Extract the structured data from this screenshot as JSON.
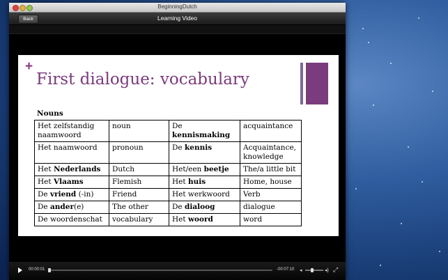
{
  "window": {
    "title": "BeginningDutch"
  },
  "navbar": {
    "back_label": "Back",
    "title": "Learning Video"
  },
  "slide": {
    "title": "First dialogue: vocabulary",
    "section": "Nouns",
    "rows": [
      {
        "dutch_prefix": "Het zelfstandig naamwoord",
        "dutch_bold": "",
        "dutch_suffix": "",
        "type": "noun",
        "nl": [
          "De ",
          "kennismaking",
          ""
        ],
        "en": "acquaintance"
      },
      {
        "dutch_prefix": "Het naamwoord",
        "dutch_bold": "",
        "dutch_suffix": "",
        "type": "pronoun",
        "nl": [
          "De ",
          "kennis",
          ""
        ],
        "en": "Acquaintance, knowledge"
      },
      {
        "dutch_prefix": "Het ",
        "dutch_bold": "Nederlands",
        "dutch_suffix": "",
        "type": "Dutch",
        "nl": [
          "Het/een ",
          "beetje",
          ""
        ],
        "en": "The/a little bit"
      },
      {
        "dutch_prefix": "Het ",
        "dutch_bold": "Vlaams",
        "dutch_suffix": "",
        "type": "Flemish",
        "nl": [
          "Het ",
          "huis",
          ""
        ],
        "en": "Home, house"
      },
      {
        "dutch_prefix": "De ",
        "dutch_bold": "vriend",
        "dutch_suffix": " (-in)",
        "type": "Friend",
        "nl": [
          "Het werkwoord",
          "",
          ""
        ],
        "en": "Verb"
      },
      {
        "dutch_prefix": "De ",
        "dutch_bold": "ander",
        "dutch_suffix": "(e)",
        "type": "The other",
        "nl": [
          "De ",
          "dialoog",
          ""
        ],
        "en": "dialogue"
      },
      {
        "dutch_prefix": "De woordenschat",
        "dutch_bold": "",
        "dutch_suffix": "",
        "type": "vocabulary",
        "nl": [
          "Het ",
          "woord",
          ""
        ],
        "en": "word"
      }
    ]
  },
  "controls": {
    "current_time": "00:00:01",
    "remaining_time": "-00:07:10",
    "progress_fraction": 0.003,
    "volume_fraction": 0.4
  },
  "colors": {
    "accent": "#7a3a7c",
    "bar_light": "#7a6a9a"
  },
  "icons": {
    "play": "play-icon",
    "volume_low": "volume-low-icon",
    "volume_high": "volume-high-icon",
    "fullscreen": "fullscreen-icon"
  }
}
